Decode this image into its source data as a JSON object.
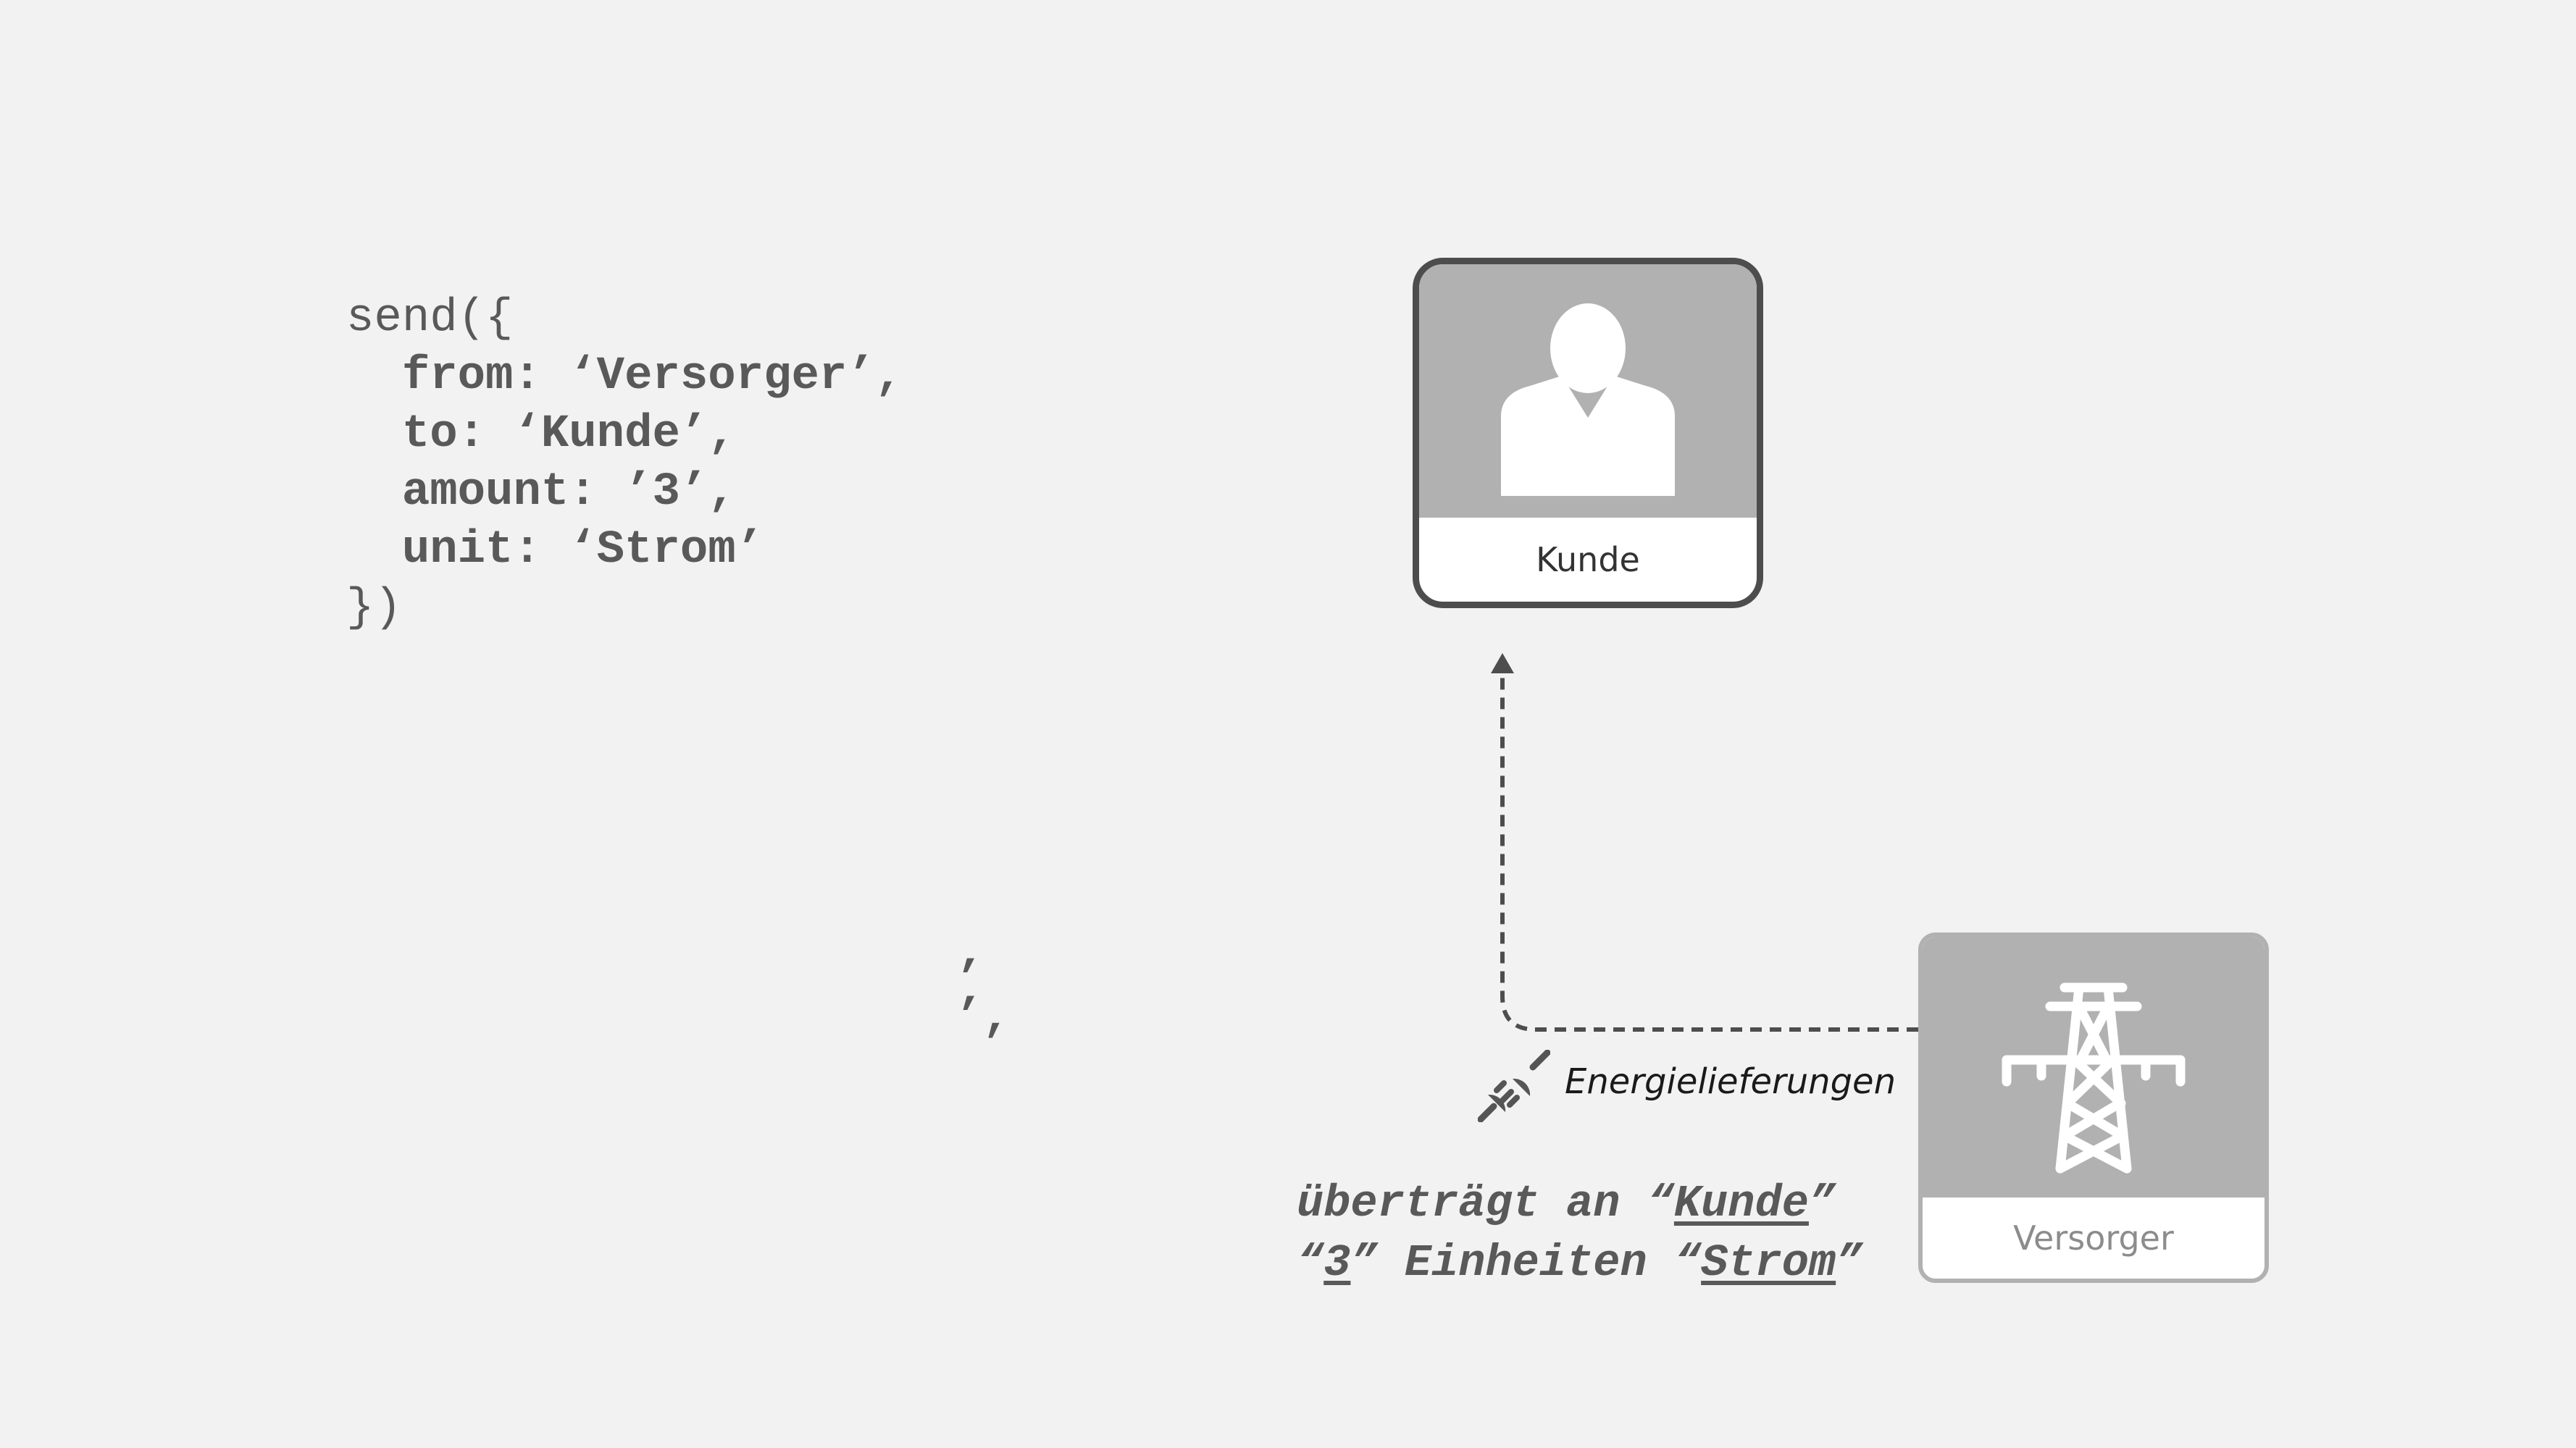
{
  "code": {
    "open": "send({",
    "from_line": "  from: ‘Versorger’,",
    "to_line": "  to: ‘Kunde’,",
    "amount_line": "  amount: ’3’,",
    "unit_line": "  unit: ‘Strom’",
    "close": "})"
  },
  "stray": {
    "mark1": "’",
    "mark2": "’,"
  },
  "nodes": {
    "kunde": {
      "label": "Kunde",
      "icon": "person-icon"
    },
    "versorger": {
      "label": "Versorger",
      "icon": "power-tower-icon"
    }
  },
  "edge": {
    "label": "Energielieferungen",
    "icon": "plug-icon",
    "style": "dashed"
  },
  "caption": {
    "line1_prefix": "überträgt an “",
    "line1_target": "Kunde",
    "line1_suffix": "”",
    "line2_open": "“",
    "line2_amount": "3",
    "line2_mid": "” Einheiten “",
    "line2_unit": "Strom",
    "line2_close": "”"
  },
  "colors": {
    "background": "#f2f2f2",
    "node_header": "#b1b1b1",
    "text": "#595959",
    "edge": "#4d4d4d"
  }
}
